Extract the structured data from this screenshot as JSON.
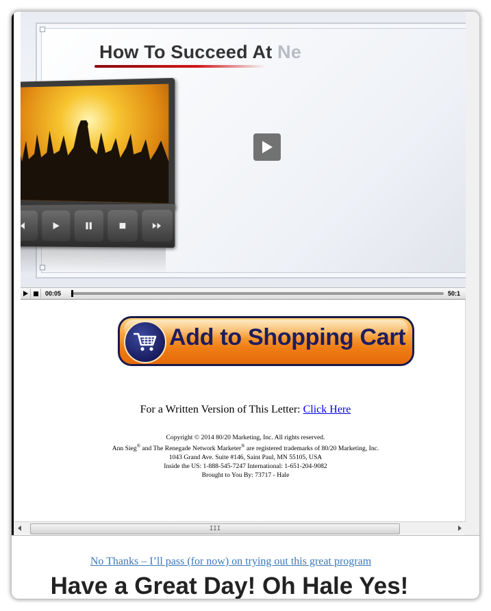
{
  "video": {
    "title_main": "How To Succeed At ",
    "title_fade": "Ne",
    "player": {
      "current_time": "00:05",
      "duration": "50:1",
      "progress": 0.0
    }
  },
  "cart_button": {
    "label": "Add to Shopping Cart",
    "icon": "shopping-cart-icon"
  },
  "written_version": {
    "prefix": "For a Written Version of This Letter: ",
    "link": "Click Here"
  },
  "legal": {
    "copyright": "Copyright © 2014 80/20 Marketing, Inc. All rights reserved.",
    "trademark_a": "Ann Sieg",
    "trademark_b": " and The Renegade Network Marketer",
    "trademark_c": " are registered trademarks of 80/20 Marketing, Inc.",
    "reg_mark": "®",
    "address": "1043 Grand Ave. Suite #146, Saint Paul, MN 55105, USA",
    "phones": "Inside the US: 1-888-545-7247 International: 1-651-204-9082",
    "brought_by": "Brought to You By: 73717 - Hale"
  },
  "scrollbar": {
    "grip": "III"
  },
  "no_thanks": "No Thanks – I’ll pass (for now) on trying out this great program",
  "headline": "Have a Great Day! Oh Hale Yes!",
  "colors": {
    "cart_orange": "#ef7d14",
    "cart_navy": "#1d1d5e",
    "link_blue": "#0000ee",
    "no_thanks_blue": "#3b78b8"
  }
}
